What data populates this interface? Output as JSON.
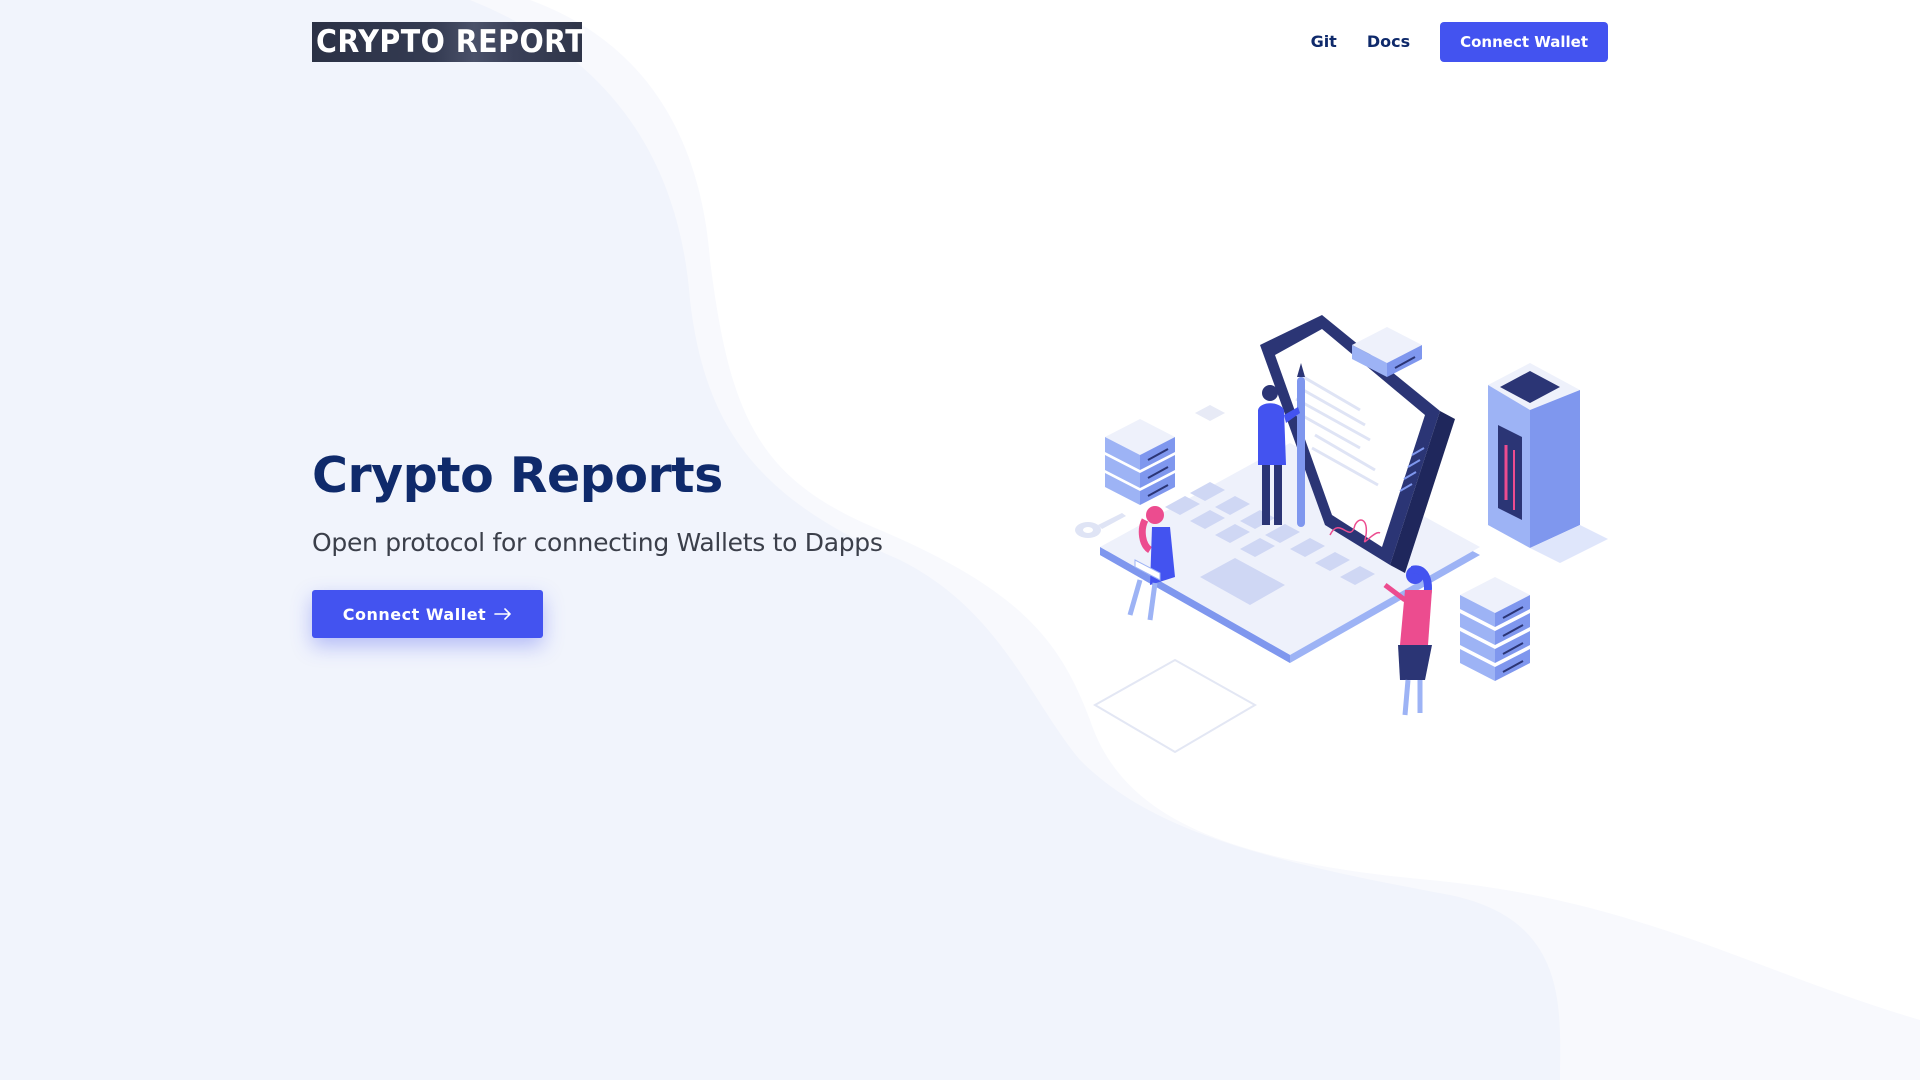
{
  "header": {
    "logo_text": "CRYPTO REPORT",
    "nav": {
      "git_label": "Git",
      "docs_label": "Docs",
      "connect_label": "Connect Wallet"
    }
  },
  "hero": {
    "title": "Crypto Reports",
    "subtitle": "Open protocol for connecting Wallets to Dapps",
    "cta_label": "Connect Wallet",
    "cta_icon": "arrow-right-icon"
  },
  "colors": {
    "primary": "#4353f0",
    "heading": "#0f2a6b",
    "text": "#3b3f4a",
    "wave": "#f1f4fc"
  }
}
